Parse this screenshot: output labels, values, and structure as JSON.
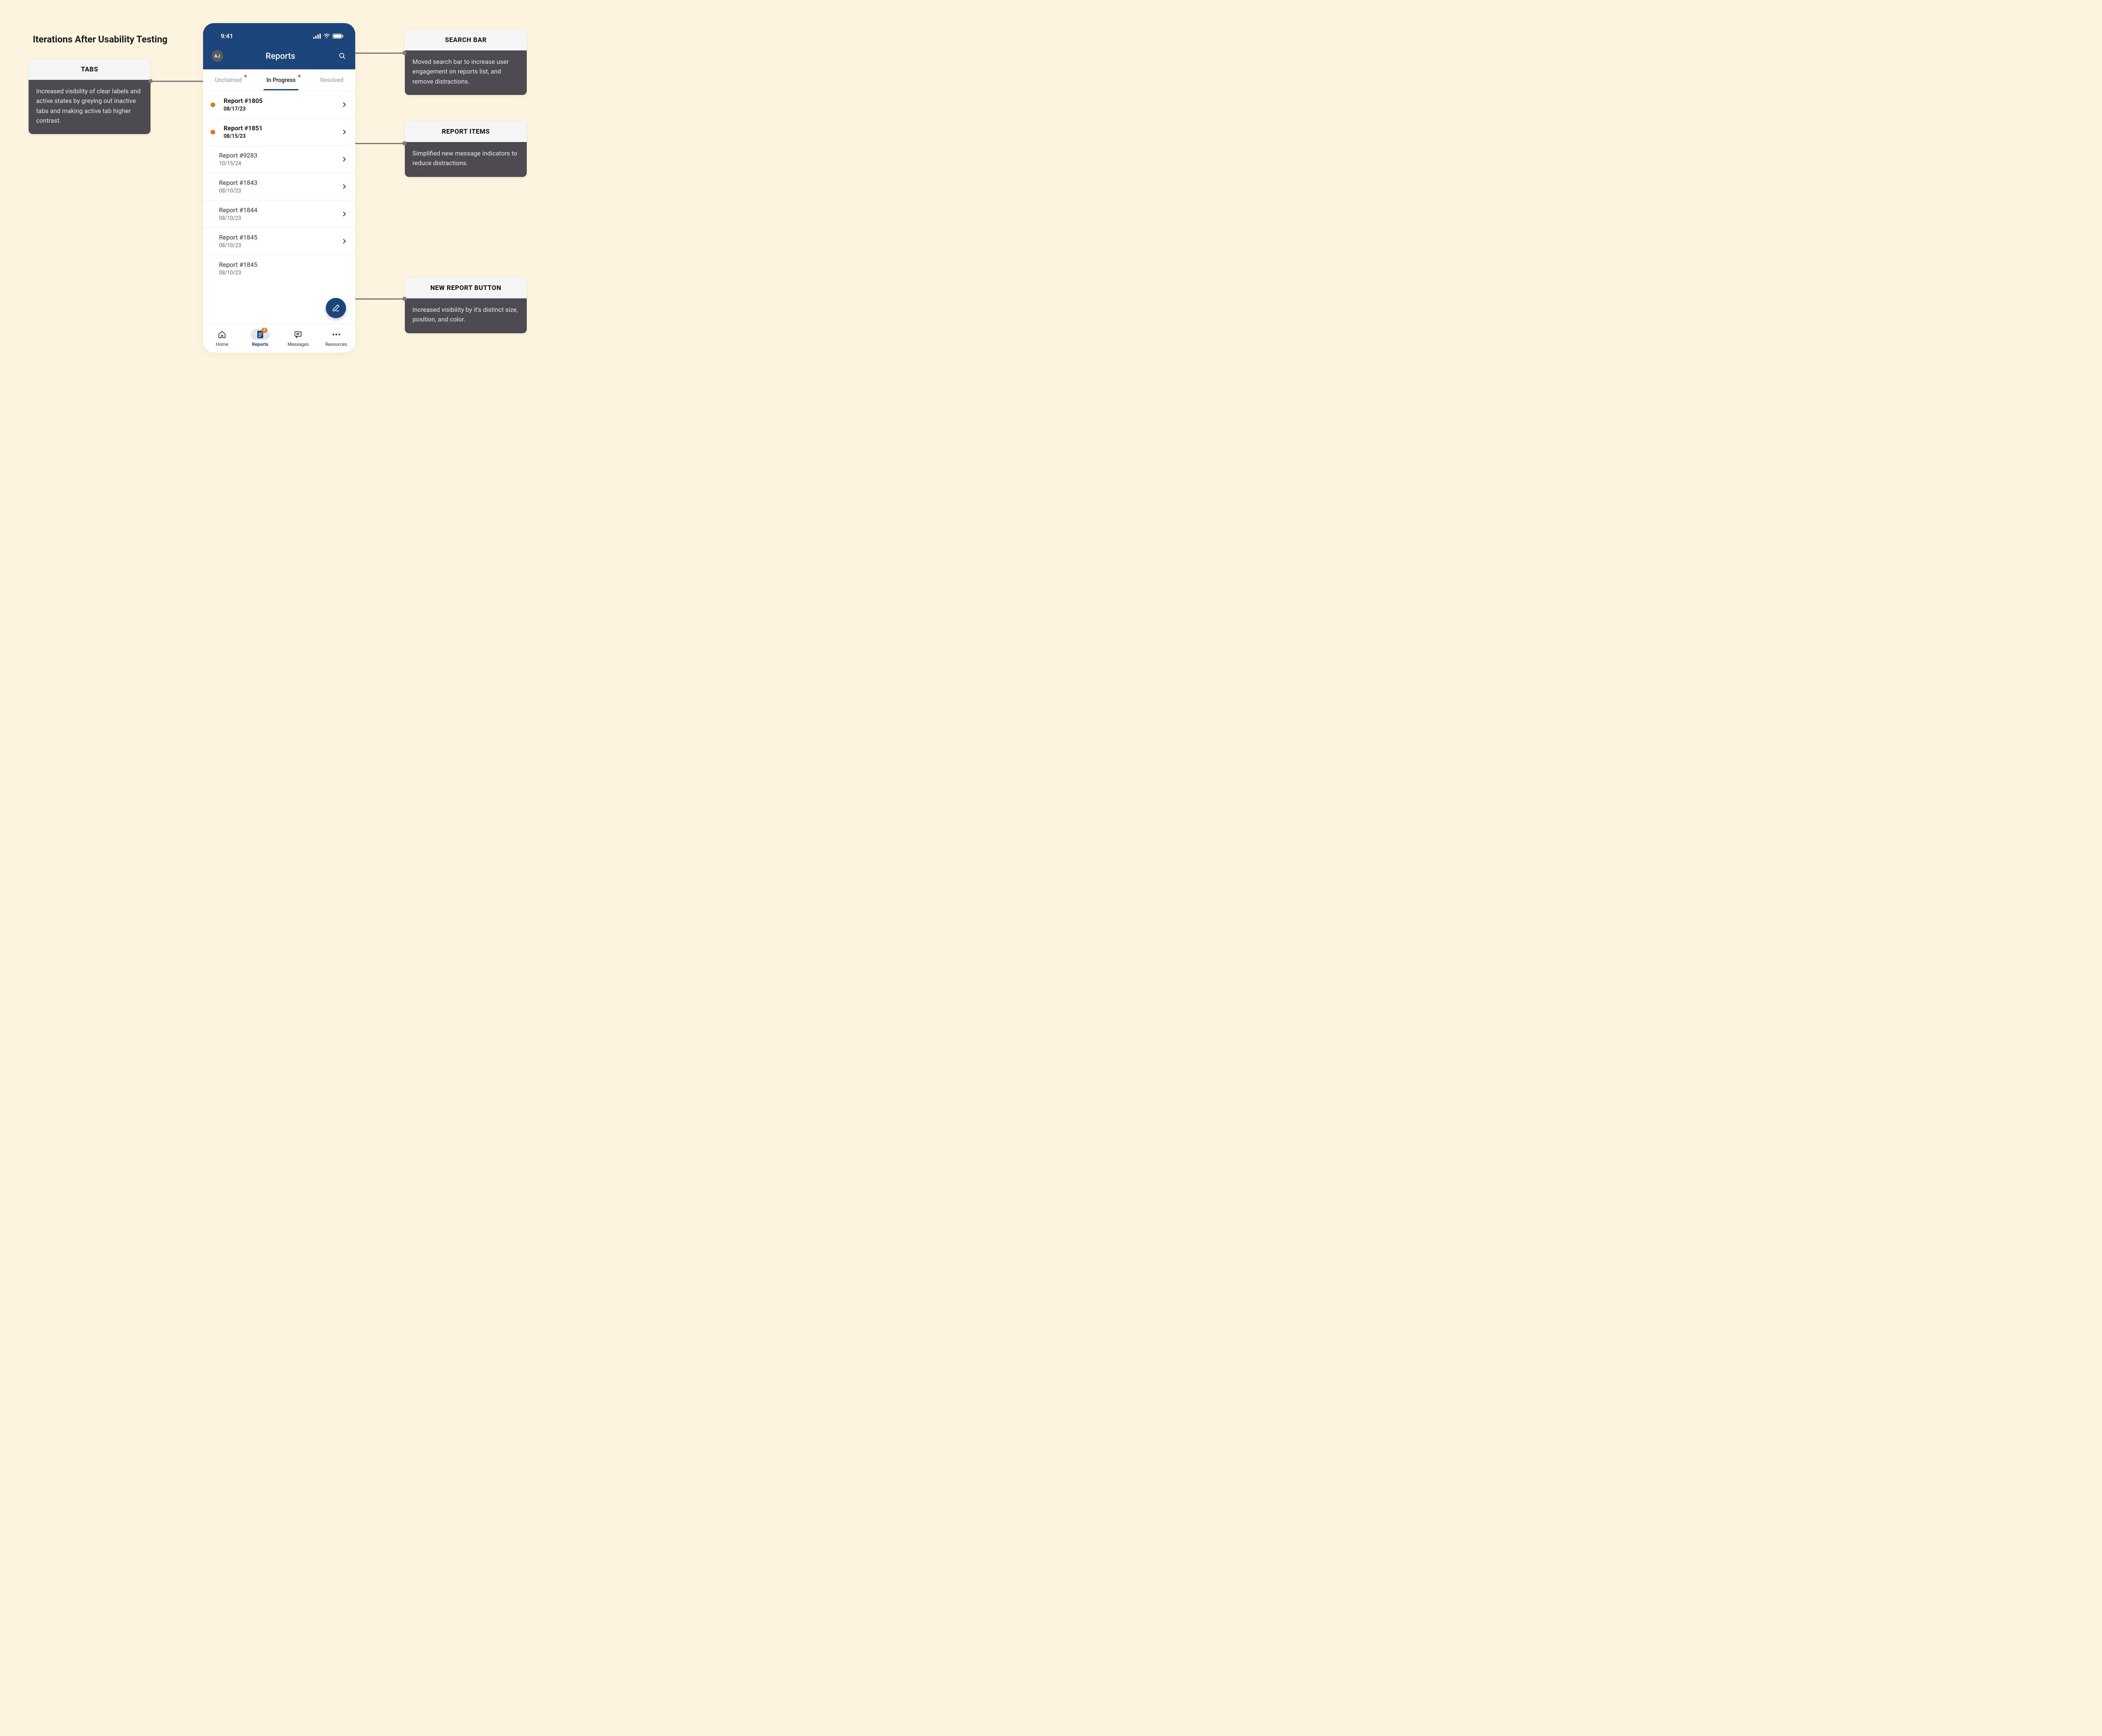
{
  "page": {
    "title": "Iterations After Usability Testing"
  },
  "annotations": {
    "tabs": {
      "heading": "TABS",
      "body": "Increased visibility of clear labels and active states by greying out inactive tabs and making active tab higher contrast."
    },
    "search": {
      "heading": "SEARCH BAR",
      "body": "Moved search bar to increase user engagement on reports list, and remove distractions."
    },
    "items": {
      "heading": "REPORT ITEMS",
      "body": "Simplified new message indicators to reduce distractions."
    },
    "button": {
      "heading": "NEW REPORT BUTTON",
      "body": "Increased visibility by it's distinct size, position, and color."
    }
  },
  "phone": {
    "statusTime": "9:41",
    "avatarInitials": "AJ",
    "headerTitle": "Reports",
    "tabs": [
      {
        "label": "Unclaimed",
        "active": false,
        "dot": true
      },
      {
        "label": "In Progress",
        "active": true,
        "dot": true
      },
      {
        "label": "Resolved",
        "active": false,
        "dot": false
      }
    ],
    "reports": [
      {
        "title": "Report #1805",
        "date": "08/17/23",
        "unread": true
      },
      {
        "title": "Report #1851",
        "date": "08/15/23",
        "unread": true
      },
      {
        "title": "Report #9283",
        "date": "10/15/24",
        "unread": false
      },
      {
        "title": "Report #1843",
        "date": "08/10/23",
        "unread": false
      },
      {
        "title": "Report #1844",
        "date": "08/10/23",
        "unread": false
      },
      {
        "title": "Report #1845",
        "date": "08/10/23",
        "unread": false
      },
      {
        "title": "Report #1845",
        "date": "08/10/23",
        "unread": false
      }
    ],
    "nav": {
      "home": "Home",
      "reports": "Reports",
      "messages": "Messages",
      "resources": "Resources",
      "badge": "4"
    }
  }
}
